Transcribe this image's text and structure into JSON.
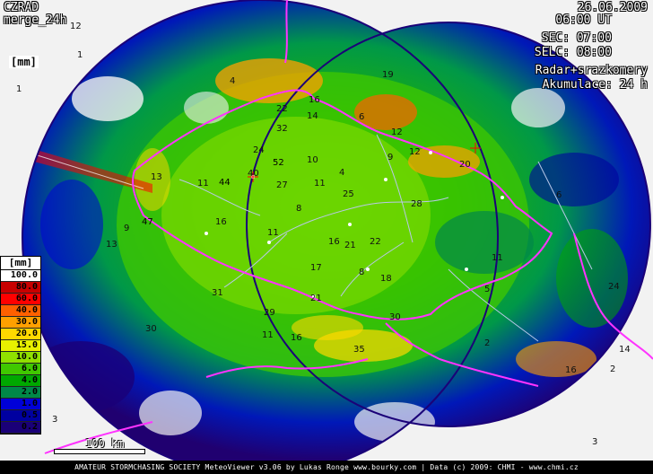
{
  "header": {
    "product": "CZRAD",
    "product_sub": "merge_24h",
    "date": "26.06.2009",
    "time": "06:00 UT",
    "sec": "SEC: 07:00",
    "selc": "SELC: 08:00",
    "method": "Radar+srazkomery",
    "accumulation": "Akumulace: 24 h"
  },
  "unit_label": "[mm]",
  "legend": {
    "title": "[mm]",
    "entries": [
      {
        "label": "100.0",
        "color": "#ffffff",
        "text": "#000000"
      },
      {
        "label": "80.0",
        "color": "#c80000",
        "text": "#000000"
      },
      {
        "label": "60.0",
        "color": "#ff0000",
        "text": "#000000"
      },
      {
        "label": "40.0",
        "color": "#ff6000",
        "text": "#000000"
      },
      {
        "label": "30.0",
        "color": "#ffa000",
        "text": "#000000"
      },
      {
        "label": "20.0",
        "color": "#ffd800",
        "text": "#000000"
      },
      {
        "label": "15.0",
        "color": "#e8f000",
        "text": "#000000"
      },
      {
        "label": "10.0",
        "color": "#90e000",
        "text": "#000000"
      },
      {
        "label": "6.0",
        "color": "#40c800",
        "text": "#000000"
      },
      {
        "label": "4.0",
        "color": "#00a800",
        "text": "#000000"
      },
      {
        "label": "2.0",
        "color": "#008848",
        "text": "#000000"
      },
      {
        "label": "1.0",
        "color": "#0000d8",
        "text": "#000000"
      },
      {
        "label": "0.5",
        "color": "#0000a0",
        "text": "#000000"
      },
      {
        "label": "0.2",
        "color": "#1a0078",
        "text": "#000000"
      }
    ]
  },
  "scale": {
    "label": "100 km"
  },
  "footer": "AMATEUR STORMCHASING SOCIETY MeteoViewer v3.06 by Lukas Ronge www.bourky.com | Data (c) 2009: CHMI - www.chmi.cz",
  "colors": {
    "border": "#ff33ff",
    "rivers": "#b8c8e8",
    "dry": "#f2f2f2"
  },
  "rain_values": {
    "note_labels": [
      "12",
      "1",
      "1",
      "4",
      "12",
      "19",
      "16",
      "22",
      "14",
      "6",
      "32",
      "12",
      "24",
      "52",
      "10",
      "40",
      "11",
      "44",
      "27",
      "11",
      "4",
      "25",
      "28",
      "9",
      "20",
      "13",
      "9",
      "47",
      "16",
      "11",
      "13",
      "16",
      "21",
      "22",
      "17",
      "18",
      "31",
      "21",
      "29",
      "11",
      "16",
      "30",
      "35",
      "30",
      "24",
      "16",
      "14",
      "2",
      "3",
      "6",
      "11",
      "5",
      "2",
      "8",
      "8",
      "3"
    ]
  }
}
